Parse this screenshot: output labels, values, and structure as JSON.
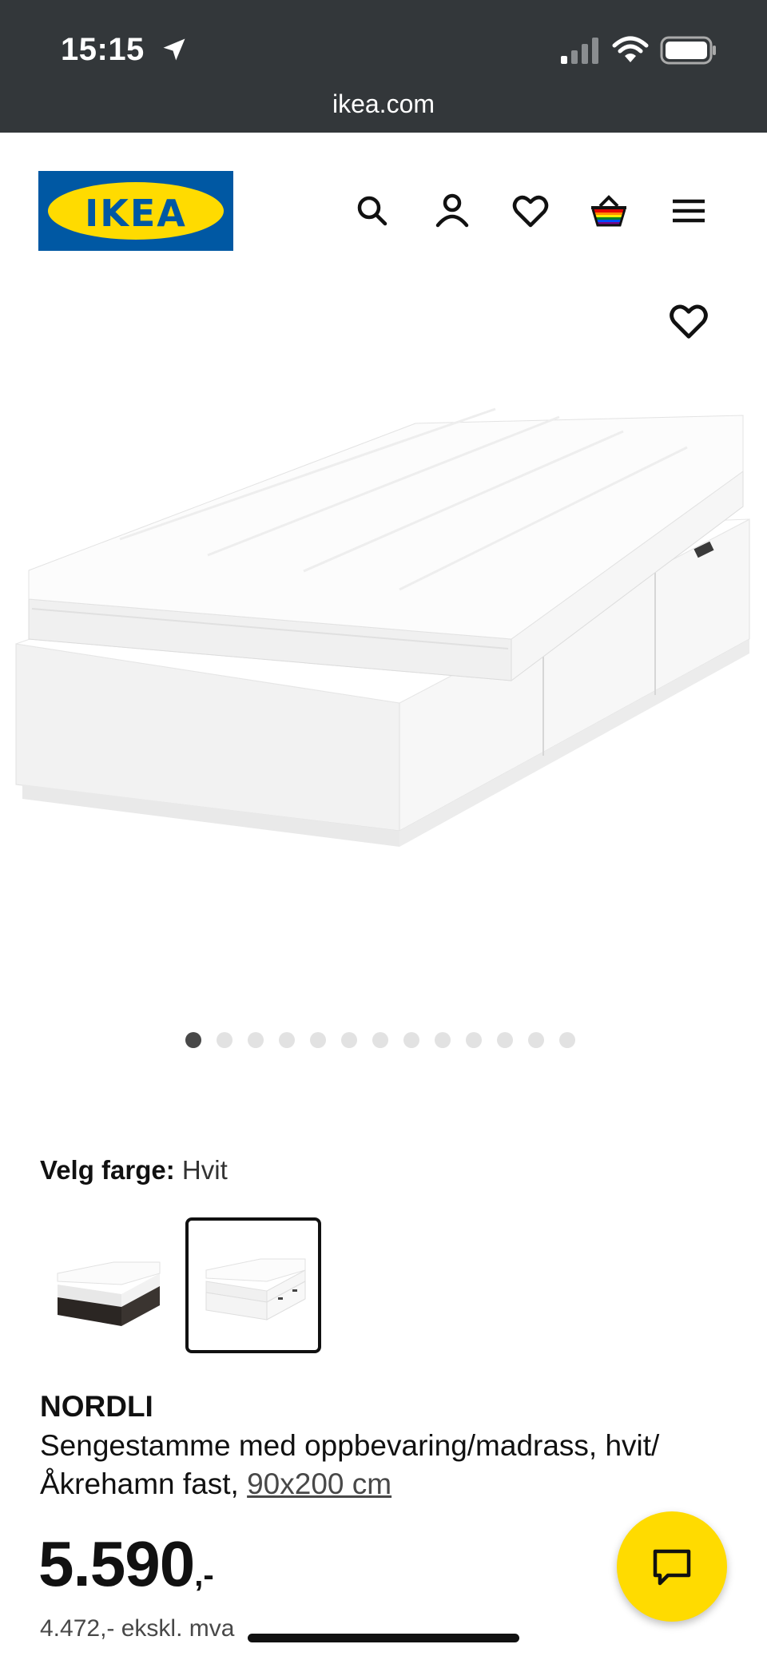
{
  "status_bar": {
    "time": "15:15",
    "url": "ikea.com"
  },
  "header": {
    "logo_text": "IKEA"
  },
  "gallery": {
    "slide_count": 13,
    "active_index": 0
  },
  "color_picker": {
    "label": "Velg farge:",
    "value": "Hvit",
    "options": [
      {
        "name": "svart",
        "selected": false
      },
      {
        "name": "hvit",
        "selected": true
      }
    ]
  },
  "product": {
    "name": "NORDLI",
    "description": "Sengestamme med oppbevaring/madrass, hvit/Åkrehamn fast, ",
    "size_link": "90x200 cm",
    "price_main": "5.590",
    "price_suffix": ",-",
    "price_ex_vat": "4.472,- ekskl. mva"
  },
  "colors": {
    "brand_blue": "#0058a3",
    "brand_yellow": "#ffdb00",
    "status_bar_bg": "#33373a"
  }
}
